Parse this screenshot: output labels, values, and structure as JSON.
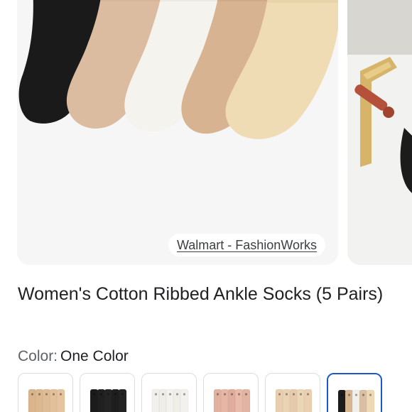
{
  "product": {
    "source": "Walmart - FashionWorks",
    "title": "Women's Cotton Ribbed Ankle Socks (5 Pairs)",
    "color_label": "Color:",
    "color_value": "One Color"
  },
  "swatches": [
    {
      "name": "swatch-tan",
      "sock_colors": [
        "#d9b48c",
        "#dcb890",
        "#dfbc95",
        "#e2c09a",
        "#e5c59f"
      ],
      "selected": false
    },
    {
      "name": "swatch-black",
      "sock_colors": [
        "#1b1b1b",
        "#202020",
        "#242424",
        "#1e1e1e",
        "#222222"
      ],
      "selected": false
    },
    {
      "name": "swatch-white",
      "sock_colors": [
        "#f1f0ec",
        "#eeede8",
        "#f3f2ee",
        "#efeee9",
        "#f2f1ed"
      ],
      "selected": false
    },
    {
      "name": "swatch-pink",
      "sock_colors": [
        "#e3b1a0",
        "#e6b7a6",
        "#e0ad9c",
        "#e8bbaa",
        "#e4b4a3"
      ],
      "selected": false
    },
    {
      "name": "swatch-beige",
      "sock_colors": [
        "#e8cfae",
        "#ead3b3",
        "#e6cbab",
        "#ecd6b7",
        "#e9d1b0"
      ],
      "selected": false
    },
    {
      "name": "swatch-mixed",
      "sock_colors": [
        "#1c1c1c",
        "#d7b692",
        "#f1efea",
        "#d9bfa3",
        "#efd9b4"
      ],
      "selected": true
    }
  ],
  "colors": {
    "card_bg": "#f5f5f5",
    "selected_border": "#1a57c8",
    "sock_black": "#1a1a1a",
    "sock_tan": "#dcbca0",
    "sock_white": "#f4f3ee",
    "sock_nude": "#d8b392",
    "sock_cream": "#f0dcb4"
  }
}
